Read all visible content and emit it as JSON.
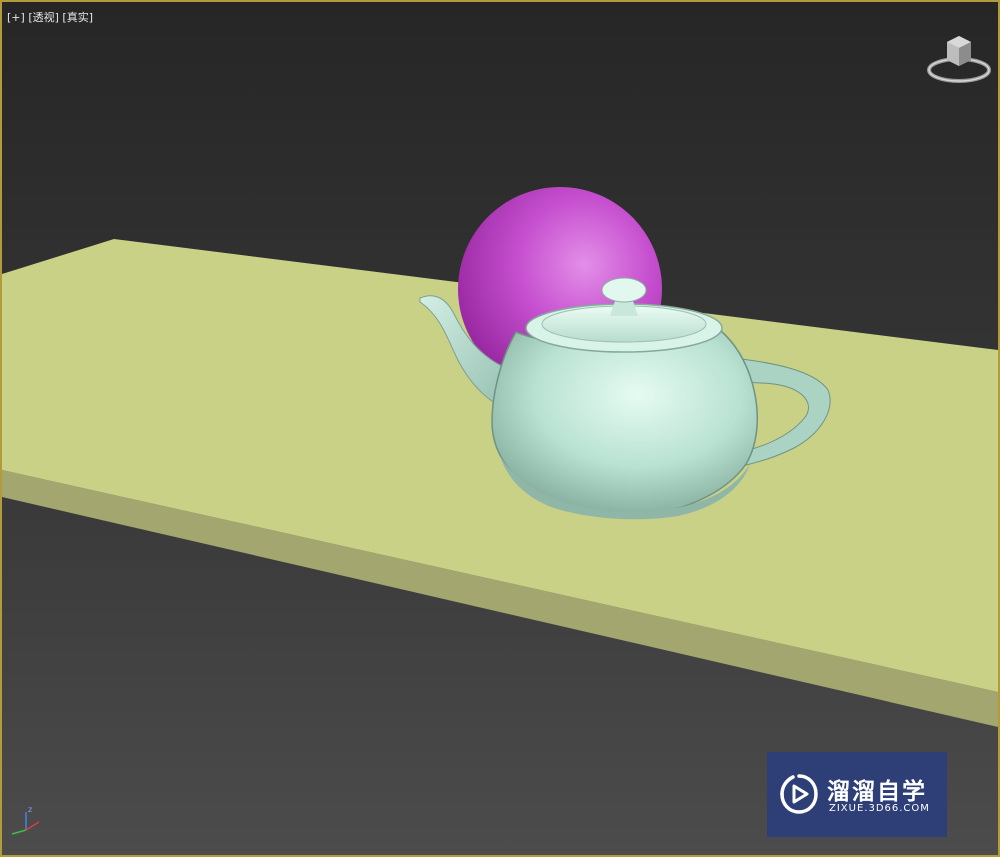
{
  "viewport": {
    "menu_plus": "[+]",
    "menu_view": "[透视]",
    "menu_shading": "[真实]"
  },
  "scene": {
    "objects": [
      "plane-table",
      "sphere",
      "teapot"
    ],
    "colors": {
      "background_top": "#262626",
      "background_bottom": "#4a4a4a",
      "table_top": "#c9d186",
      "table_side": "#a2a46f",
      "sphere": "#c04cc8",
      "teapot": "#bfe6d6",
      "viewport_border": "#b49b3a"
    }
  },
  "watermark": {
    "title": "溜溜自学",
    "url": "ZIXUE.3D66.COM",
    "bg_color": "#2e3f78"
  },
  "axis": {
    "z_label": "z"
  }
}
